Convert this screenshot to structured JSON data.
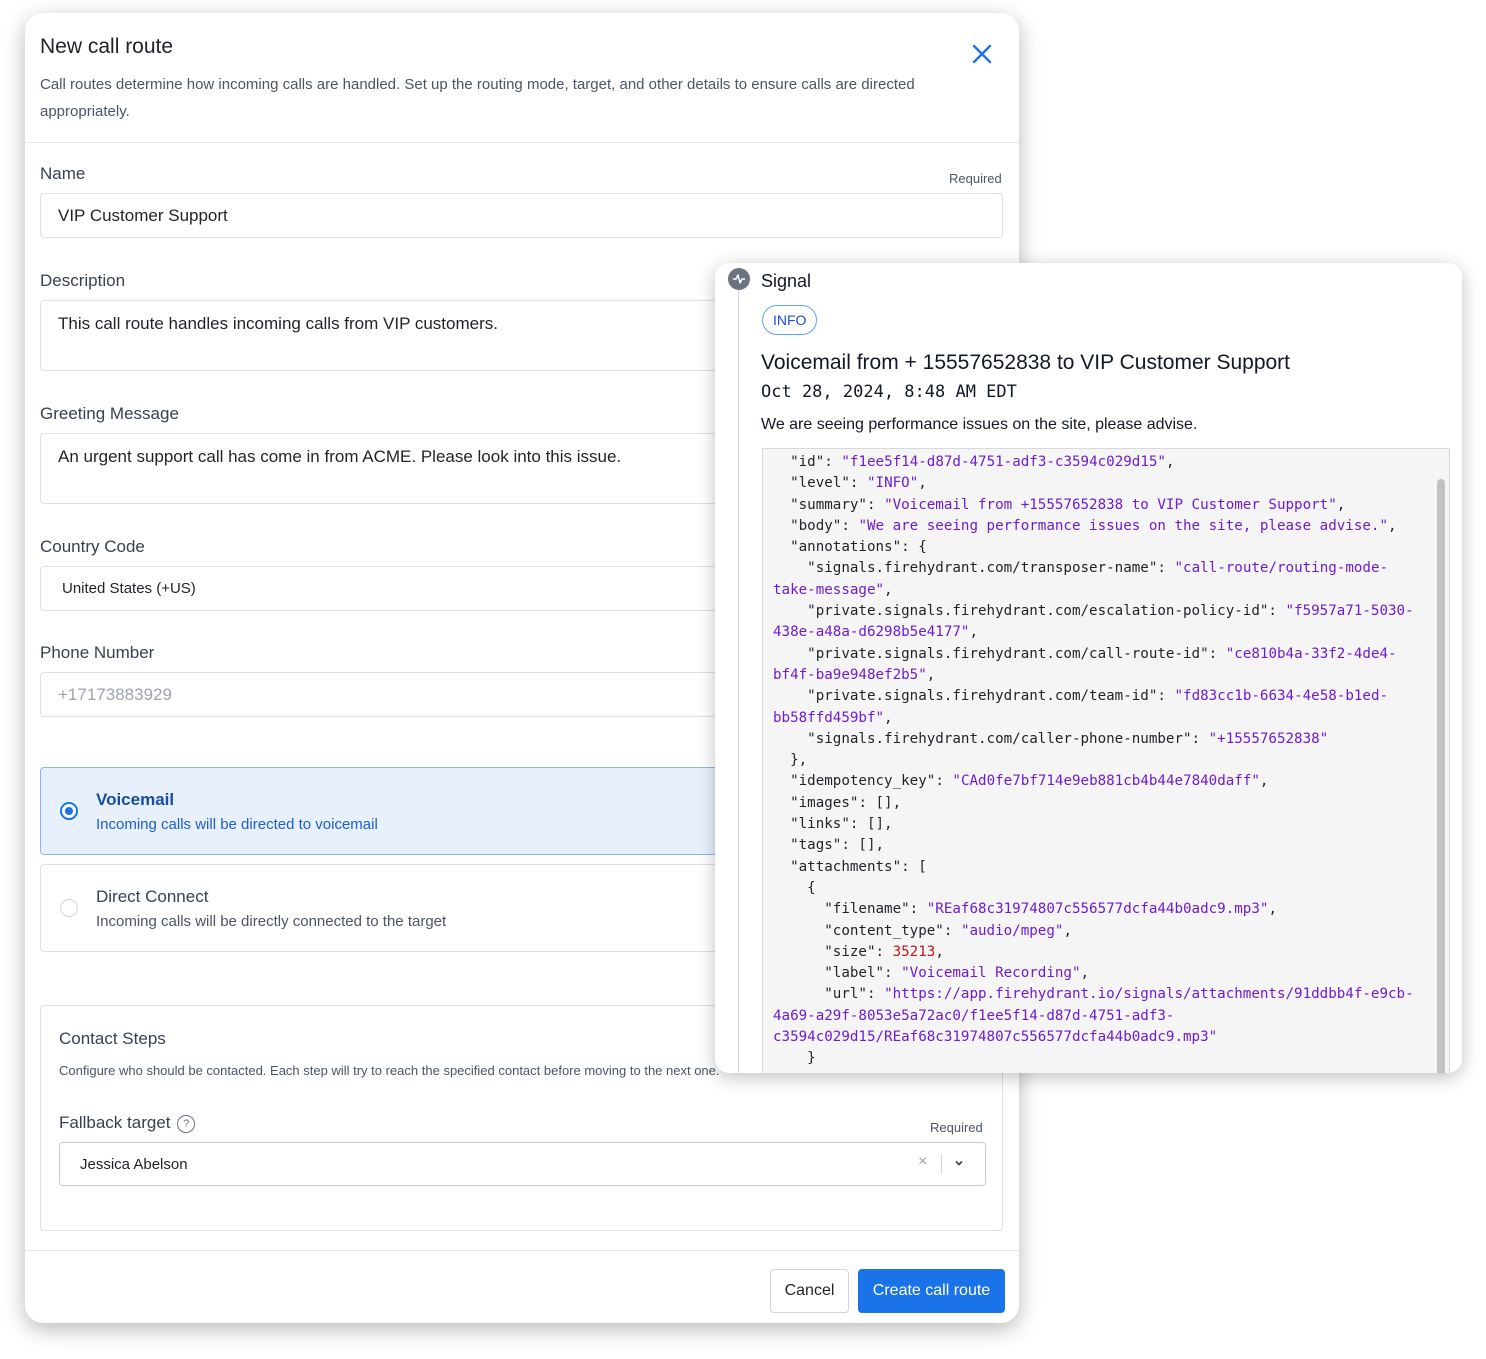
{
  "modal": {
    "title": "New call route",
    "subtitle": "Call routes determine how incoming calls are handled. Set up the routing mode, target, and other details to ensure calls are directed appropriately.",
    "fields": {
      "name": {
        "label": "Name",
        "required": "Required",
        "value": "VIP Customer Support"
      },
      "description": {
        "label": "Description",
        "value": "This call route handles incoming calls from VIP customers."
      },
      "greeting": {
        "label": "Greeting Message",
        "value": "An urgent support call has come in from ACME. Please look into this issue."
      },
      "country": {
        "label": "Country Code",
        "value": "United States (+US)"
      },
      "phone": {
        "label": "Phone Number",
        "placeholder": "+17173883929"
      }
    },
    "routing_options": [
      {
        "title": "Voicemail",
        "desc": "Incoming calls will be directed to voicemail",
        "selected": true
      },
      {
        "title": "Direct Connect",
        "desc": "Incoming calls will be directly connected to the target",
        "selected": false
      }
    ],
    "contact_steps": {
      "title": "Contact Steps",
      "desc": "Configure who should be contacted. Each step will try to reach the specified contact before moving to the next one.",
      "fallback_label": "Fallback target",
      "required": "Required",
      "fallback_value": "Jessica Abelson"
    },
    "footer": {
      "cancel": "Cancel",
      "create": "Create call route"
    }
  },
  "signal": {
    "title": "Signal",
    "badge": "INFO",
    "headline": "Voicemail from + 15557652838 to VIP Customer Support",
    "timestamp": "Oct 28, 2024, 8:48 AM EDT",
    "body": "We are seeing performance issues on the site, please advise.",
    "json_lines": [
      [
        [
          "  ",
          ""
        ],
        [
          "\"id\"",
          ""
        ],
        [
          ": ",
          ""
        ],
        [
          "\"f1ee5f14-d87d-4751-adf3-c3594c029d15\"",
          "s"
        ],
        [
          ",",
          ""
        ]
      ],
      [
        [
          "  ",
          ""
        ],
        [
          "\"level\"",
          ""
        ],
        [
          ": ",
          ""
        ],
        [
          "\"INFO\"",
          "s"
        ],
        [
          ",",
          ""
        ]
      ],
      [
        [
          "  ",
          ""
        ],
        [
          "\"summary\"",
          ""
        ],
        [
          ": ",
          ""
        ],
        [
          "\"Voicemail from +15557652838 to VIP Customer Support\"",
          "s"
        ],
        [
          ",",
          ""
        ]
      ],
      [
        [
          "  ",
          ""
        ],
        [
          "\"body\"",
          ""
        ],
        [
          ": ",
          ""
        ],
        [
          "\"We are seeing performance issues on the site, please advise.\"",
          "s"
        ],
        [
          ",",
          ""
        ]
      ],
      [
        [
          "  ",
          ""
        ],
        [
          "\"annotations\"",
          ""
        ],
        [
          ": {",
          ""
        ]
      ],
      [
        [
          "    ",
          ""
        ],
        [
          "\"signals.firehydrant.com/transposer-name\"",
          ""
        ],
        [
          ": ",
          ""
        ],
        [
          "\"call-route/routing-mode-",
          "s"
        ]
      ],
      [
        [
          "take-message\"",
          "s"
        ],
        [
          ",",
          ""
        ]
      ],
      [
        [
          "    ",
          ""
        ],
        [
          "\"private.signals.firehydrant.com/escalation-policy-id\"",
          ""
        ],
        [
          ": ",
          ""
        ],
        [
          "\"f5957a71-5030-",
          "s"
        ]
      ],
      [
        [
          "438e-a48a-d6298b5e4177\"",
          "s"
        ],
        [
          ",",
          ""
        ]
      ],
      [
        [
          "    ",
          ""
        ],
        [
          "\"private.signals.firehydrant.com/call-route-id\"",
          ""
        ],
        [
          ": ",
          ""
        ],
        [
          "\"ce810b4a-33f2-4de4-",
          "s"
        ]
      ],
      [
        [
          "bf4f-ba9e948ef2b5\"",
          "s"
        ],
        [
          ",",
          ""
        ]
      ],
      [
        [
          "    ",
          ""
        ],
        [
          "\"private.signals.firehydrant.com/team-id\"",
          ""
        ],
        [
          ": ",
          ""
        ],
        [
          "\"fd83cc1b-6634-4e58-b1ed-",
          "s"
        ]
      ],
      [
        [
          "bb58ffd459bf\"",
          "s"
        ],
        [
          ",",
          ""
        ]
      ],
      [
        [
          "    ",
          ""
        ],
        [
          "\"signals.firehydrant.com/caller-phone-number\"",
          ""
        ],
        [
          ": ",
          ""
        ],
        [
          "\"+15557652838\"",
          "s"
        ]
      ],
      [
        [
          "  },",
          ""
        ]
      ],
      [
        [
          "  ",
          ""
        ],
        [
          "\"idempotency_key\"",
          ""
        ],
        [
          ": ",
          ""
        ],
        [
          "\"CAd0fe7bf714e9eb881cb4b44e7840daff\"",
          "s"
        ],
        [
          ",",
          ""
        ]
      ],
      [
        [
          "  ",
          ""
        ],
        [
          "\"images\"",
          ""
        ],
        [
          ": [],",
          ""
        ]
      ],
      [
        [
          "  ",
          ""
        ],
        [
          "\"links\"",
          ""
        ],
        [
          ": [],",
          ""
        ]
      ],
      [
        [
          "  ",
          ""
        ],
        [
          "\"tags\"",
          ""
        ],
        [
          ": [],",
          ""
        ]
      ],
      [
        [
          "  ",
          ""
        ],
        [
          "\"attachments\"",
          ""
        ],
        [
          ": [",
          ""
        ]
      ],
      [
        [
          "    {",
          ""
        ]
      ],
      [
        [
          "      ",
          ""
        ],
        [
          "\"filename\"",
          ""
        ],
        [
          ": ",
          ""
        ],
        [
          "\"REaf68c31974807c556577dcfa44b0adc9.mp3\"",
          "s"
        ],
        [
          ",",
          ""
        ]
      ],
      [
        [
          "      ",
          ""
        ],
        [
          "\"content_type\"",
          ""
        ],
        [
          ": ",
          ""
        ],
        [
          "\"audio/mpeg\"",
          "s"
        ],
        [
          ",",
          ""
        ]
      ],
      [
        [
          "      ",
          ""
        ],
        [
          "\"size\"",
          ""
        ],
        [
          ": ",
          ""
        ],
        [
          "35213",
          "n"
        ],
        [
          ",",
          ""
        ]
      ],
      [
        [
          "      ",
          ""
        ],
        [
          "\"label\"",
          ""
        ],
        [
          ": ",
          ""
        ],
        [
          "\"Voicemail Recording\"",
          "s"
        ],
        [
          ",",
          ""
        ]
      ],
      [
        [
          "      ",
          ""
        ],
        [
          "\"url\"",
          ""
        ],
        [
          ": ",
          ""
        ],
        [
          "\"https://app.firehydrant.io/signals/attachments/91ddbb4f-e9cb-",
          "s"
        ]
      ],
      [
        [
          "4a69-a29f-8053e5a72ac0/f1ee5f14-d87d-4751-adf3-",
          "s"
        ]
      ],
      [
        [
          "c3594c029d15/REaf68c31974807c556577dcfa44b0adc9.mp3\"",
          "s"
        ]
      ],
      [
        [
          "    }",
          ""
        ]
      ]
    ]
  },
  "colors": {
    "accent": "#1a73e8",
    "selected_bg": "#e8f0fe",
    "json_string": "#6f1bd3",
    "json_number": "#c0161b"
  }
}
